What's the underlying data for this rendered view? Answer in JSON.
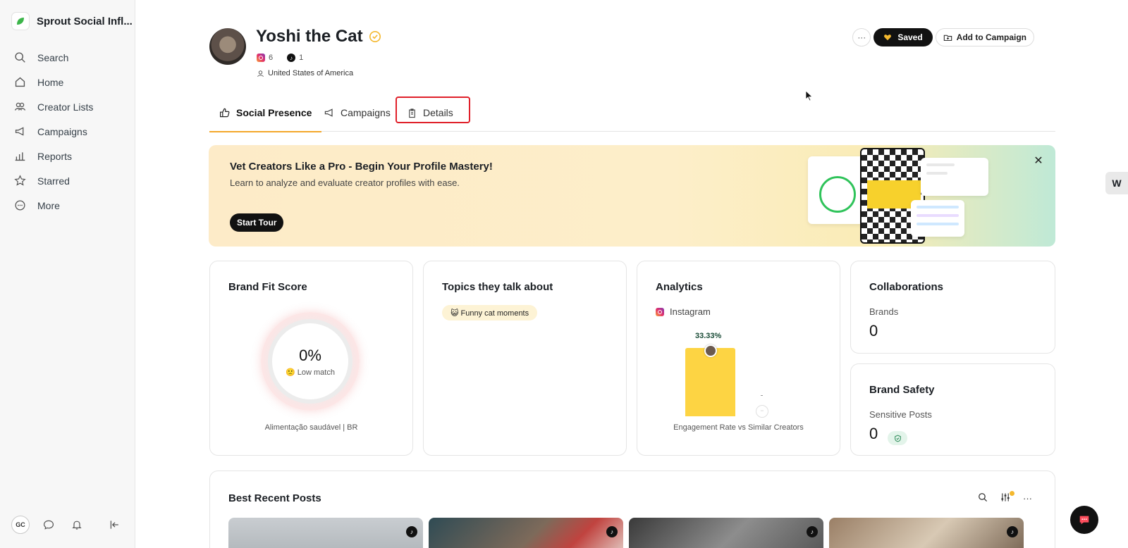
{
  "sidebar": {
    "app_name": "Sprout Social Infl...",
    "items": [
      {
        "label": "Search",
        "icon": "search-icon"
      },
      {
        "label": "Home",
        "icon": "home-icon"
      },
      {
        "label": "Creator Lists",
        "icon": "users-icon"
      },
      {
        "label": "Campaigns",
        "icon": "megaphone-icon"
      },
      {
        "label": "Reports",
        "icon": "chart-icon"
      },
      {
        "label": "Starred",
        "icon": "star-icon"
      },
      {
        "label": "More",
        "icon": "more-icon"
      }
    ],
    "user_initials": "GC"
  },
  "profile": {
    "name": "Yoshi the Cat",
    "instagram_count": "6",
    "tiktok_count": "1",
    "location": "United States of America"
  },
  "actions": {
    "more_label": "···",
    "saved_label": "Saved",
    "add_campaign_label": "Add to Campaign"
  },
  "tabs": [
    {
      "label": "Social Presence",
      "active": true
    },
    {
      "label": "Campaigns",
      "active": false
    },
    {
      "label": "Details",
      "active": false
    }
  ],
  "banner": {
    "title": "Vet Creators Like a Pro - Begin Your Profile Mastery!",
    "subtitle": "Learn to analyze and evaluate creator profiles with ease.",
    "button_label": "Start Tour"
  },
  "brand_fit": {
    "title": "Brand Fit Score",
    "value": "0%",
    "label": "🙁 Low match",
    "footer": "Alimentação saudável | BR"
  },
  "topics": {
    "title": "Topics they talk about",
    "chip": "😺 Funny cat moments"
  },
  "analytics": {
    "title": "Analytics",
    "platform": "Instagram",
    "bar_value": "33.33%",
    "bar_fraction": 0.3333,
    "axis_label": "Engagement Rate vs Similar Creators"
  },
  "collaborations": {
    "title": "Collaborations",
    "label": "Brands",
    "value": "0"
  },
  "brand_safety": {
    "title": "Brand Safety",
    "label": "Sensitive Posts",
    "value": "0"
  },
  "posts": {
    "title": "Best Recent Posts"
  },
  "colors": {
    "accent": "#f4a72b",
    "highlight": "#e0202a",
    "bar": "#fdd443"
  }
}
